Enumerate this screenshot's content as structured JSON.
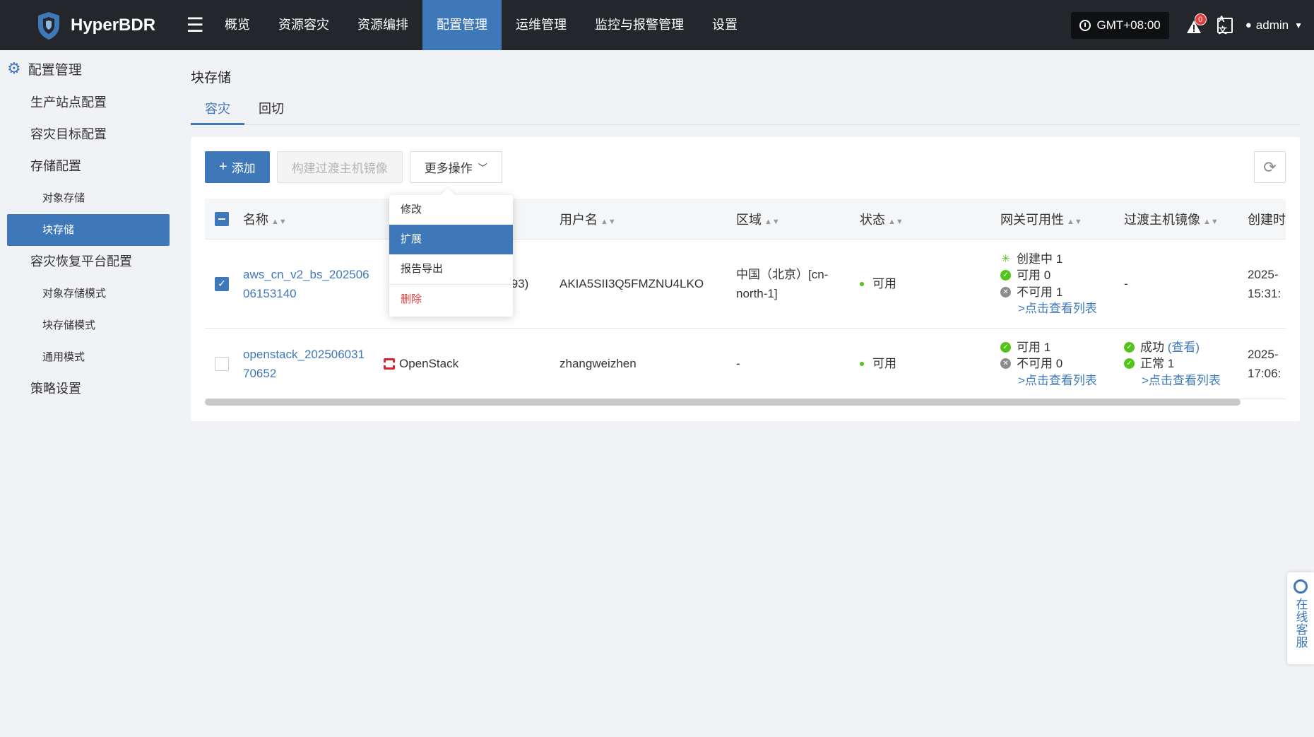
{
  "app": {
    "name": "HyperBDR",
    "nav": [
      "概览",
      "资源容灾",
      "资源编排",
      "配置管理",
      "运维管理",
      "监控与报警管理",
      "设置"
    ],
    "nav_active": "配置管理",
    "timezone": "GMT+08:00",
    "alert_count": "0",
    "lang_icon": "A文",
    "user": "admin"
  },
  "sidebar": {
    "title": "配置管理",
    "items": [
      {
        "label": "生产站点配置",
        "level": 1
      },
      {
        "label": "容灾目标配置",
        "level": 1
      },
      {
        "label": "存储配置",
        "level": 1
      },
      {
        "label": "对象存储",
        "level": 2
      },
      {
        "label": "块存储",
        "level": 2,
        "active": true
      },
      {
        "label": "容灾恢复平台配置",
        "level": 1
      },
      {
        "label": "对象存储模式",
        "level": 2
      },
      {
        "label": "块存储模式",
        "level": 2
      },
      {
        "label": "通用模式",
        "level": 2
      },
      {
        "label": "策略设置",
        "level": 1
      }
    ]
  },
  "page": {
    "title": "块存储",
    "tabs": [
      "容灾",
      "回切"
    ],
    "active_tab": "容灾"
  },
  "toolbar": {
    "add": "添加",
    "build_image": "构建过渡主机镜像",
    "more": "更多操作"
  },
  "menu": {
    "items": [
      "修改",
      "扩展",
      "报告导出",
      "删除"
    ],
    "hovered": "扩展",
    "danger": "删除"
  },
  "table": {
    "columns": [
      "名称",
      "",
      "用户名",
      "区域",
      "状态",
      "网关可用性",
      "过渡主机镜像",
      "创建时"
    ],
    "rows": [
      {
        "checked": true,
        "name_line1": "aws_cn_v2_bs_202506",
        "name_line2": "06153140",
        "type": ".93)",
        "username": "AKIA5SII3Q5FMZNU4LKO",
        "region_line1": "中国（北京）[cn-",
        "region_line2": "north-1]",
        "status": "可用",
        "gateway": [
          "创建中 1",
          "可用 0",
          "不可用 1"
        ],
        "gateway_link": ">点击查看列表",
        "image": "-",
        "created_line1": "2025-",
        "created_line2": "15:31:"
      },
      {
        "checked": false,
        "name_line1": "openstack_202506031",
        "name_line2": "70652",
        "type": "OpenStack",
        "username": "zhangweizhen",
        "region_line1": "-",
        "region_line2": "",
        "status": "可用",
        "gateway": [
          "可用 1",
          "不可用 0"
        ],
        "gateway_link": ">点击查看列表",
        "image_success": "成功",
        "image_view": "(查看)",
        "image_normal": "正常 1",
        "image_link": ">点击查看列表",
        "created_line1": "2025-",
        "created_line2": "17:06:"
      }
    ]
  },
  "service": {
    "label": "在线客服"
  }
}
